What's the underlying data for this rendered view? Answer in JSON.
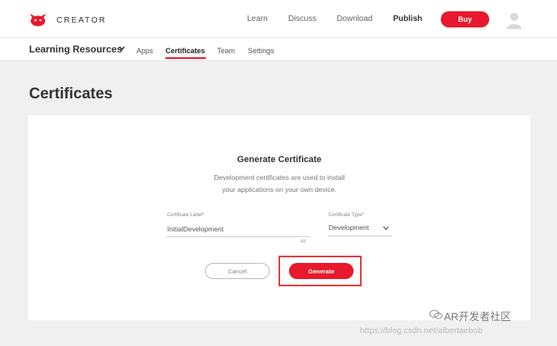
{
  "header": {
    "brand": "CREATOR",
    "logo_icon": "red-bird-logo-icon",
    "nav": [
      "Learn",
      "Discuss",
      "Download",
      "Publish"
    ],
    "buy_label": "Buy",
    "avatar_icon": "user-avatar-icon"
  },
  "subnav": {
    "title": "Learning Resources",
    "items": [
      "Apps",
      "Certificates",
      "Team",
      "Settings"
    ],
    "active": "Certificates"
  },
  "page": {
    "title": "Certificates"
  },
  "card": {
    "title": "Generate Certificate",
    "desc_line1": "Development certificates are used to install",
    "desc_line2": "your applications on your own device.",
    "label_field": {
      "label": "Certificate Label*",
      "value": "InitialDevelopment",
      "counter": "48"
    },
    "type_field": {
      "label": "Certificate Type*",
      "value": "Development"
    },
    "cancel_label": "Cancel",
    "generate_label": "Generate"
  },
  "watermark": {
    "text": "AR开发者社区",
    "url": "https://blog.csdn.net/albertaebob"
  },
  "colors": {
    "accent": "#e8192c",
    "highlight": "#e23b3b",
    "background": "#f0f0f0"
  }
}
